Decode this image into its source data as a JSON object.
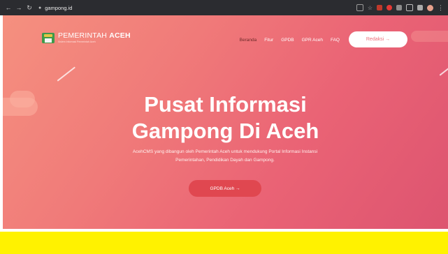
{
  "browser": {
    "url": "gampong.id",
    "nav_icons": [
      "back-arrow",
      "forward-arrow",
      "reload"
    ]
  },
  "site": {
    "brand": {
      "name_light": "PEMERINTAH",
      "name_bold": "ACEH",
      "subtitle": "Sistem Informasi Pemerintah Aceh"
    },
    "nav": [
      "Beranda",
      "Fitur",
      "GPDB",
      "GPR Aceh",
      "FAQ"
    ],
    "active_nav": "Beranda",
    "cta_top": "Redaksi →",
    "hero": {
      "title_line1": "Pusat Informasi",
      "title_line2": "Gampong Di Aceh",
      "desc_line1": "AcehCMS yang dibangun oleh Pemerintah Aceh untuk mendukung Portal Informasi Instansi",
      "desc_line2": "Pemerintahan, Pendidikan Dayah dan Gampong.",
      "button": "GPDB Aceh →"
    }
  },
  "colors": {
    "hero_start": "#f5907f",
    "hero_end": "#dd5470",
    "accent_button": "#e04750",
    "yellow_band": "#fff200"
  }
}
